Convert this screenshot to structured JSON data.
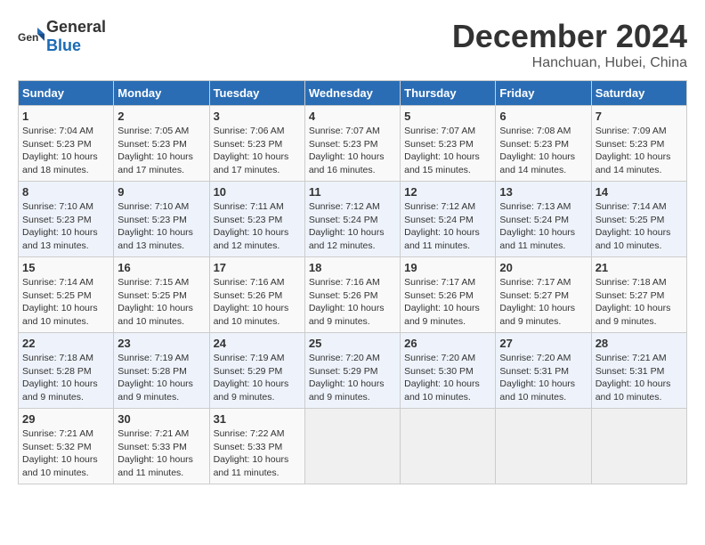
{
  "header": {
    "logo_general": "General",
    "logo_blue": "Blue",
    "month": "December 2024",
    "location": "Hanchuan, Hubei, China"
  },
  "days_of_week": [
    "Sunday",
    "Monday",
    "Tuesday",
    "Wednesday",
    "Thursday",
    "Friday",
    "Saturday"
  ],
  "weeks": [
    [
      {
        "day": "1",
        "info": "Sunrise: 7:04 AM\nSunset: 5:23 PM\nDaylight: 10 hours\nand 18 minutes."
      },
      {
        "day": "2",
        "info": "Sunrise: 7:05 AM\nSunset: 5:23 PM\nDaylight: 10 hours\nand 17 minutes."
      },
      {
        "day": "3",
        "info": "Sunrise: 7:06 AM\nSunset: 5:23 PM\nDaylight: 10 hours\nand 17 minutes."
      },
      {
        "day": "4",
        "info": "Sunrise: 7:07 AM\nSunset: 5:23 PM\nDaylight: 10 hours\nand 16 minutes."
      },
      {
        "day": "5",
        "info": "Sunrise: 7:07 AM\nSunset: 5:23 PM\nDaylight: 10 hours\nand 15 minutes."
      },
      {
        "day": "6",
        "info": "Sunrise: 7:08 AM\nSunset: 5:23 PM\nDaylight: 10 hours\nand 14 minutes."
      },
      {
        "day": "7",
        "info": "Sunrise: 7:09 AM\nSunset: 5:23 PM\nDaylight: 10 hours\nand 14 minutes."
      }
    ],
    [
      {
        "day": "8",
        "info": "Sunrise: 7:10 AM\nSunset: 5:23 PM\nDaylight: 10 hours\nand 13 minutes."
      },
      {
        "day": "9",
        "info": "Sunrise: 7:10 AM\nSunset: 5:23 PM\nDaylight: 10 hours\nand 13 minutes."
      },
      {
        "day": "10",
        "info": "Sunrise: 7:11 AM\nSunset: 5:23 PM\nDaylight: 10 hours\nand 12 minutes."
      },
      {
        "day": "11",
        "info": "Sunrise: 7:12 AM\nSunset: 5:24 PM\nDaylight: 10 hours\nand 12 minutes."
      },
      {
        "day": "12",
        "info": "Sunrise: 7:12 AM\nSunset: 5:24 PM\nDaylight: 10 hours\nand 11 minutes."
      },
      {
        "day": "13",
        "info": "Sunrise: 7:13 AM\nSunset: 5:24 PM\nDaylight: 10 hours\nand 11 minutes."
      },
      {
        "day": "14",
        "info": "Sunrise: 7:14 AM\nSunset: 5:25 PM\nDaylight: 10 hours\nand 10 minutes."
      }
    ],
    [
      {
        "day": "15",
        "info": "Sunrise: 7:14 AM\nSunset: 5:25 PM\nDaylight: 10 hours\nand 10 minutes."
      },
      {
        "day": "16",
        "info": "Sunrise: 7:15 AM\nSunset: 5:25 PM\nDaylight: 10 hours\nand 10 minutes."
      },
      {
        "day": "17",
        "info": "Sunrise: 7:16 AM\nSunset: 5:26 PM\nDaylight: 10 hours\nand 10 minutes."
      },
      {
        "day": "18",
        "info": "Sunrise: 7:16 AM\nSunset: 5:26 PM\nDaylight: 10 hours\nand 9 minutes."
      },
      {
        "day": "19",
        "info": "Sunrise: 7:17 AM\nSunset: 5:26 PM\nDaylight: 10 hours\nand 9 minutes."
      },
      {
        "day": "20",
        "info": "Sunrise: 7:17 AM\nSunset: 5:27 PM\nDaylight: 10 hours\nand 9 minutes."
      },
      {
        "day": "21",
        "info": "Sunrise: 7:18 AM\nSunset: 5:27 PM\nDaylight: 10 hours\nand 9 minutes."
      }
    ],
    [
      {
        "day": "22",
        "info": "Sunrise: 7:18 AM\nSunset: 5:28 PM\nDaylight: 10 hours\nand 9 minutes."
      },
      {
        "day": "23",
        "info": "Sunrise: 7:19 AM\nSunset: 5:28 PM\nDaylight: 10 hours\nand 9 minutes."
      },
      {
        "day": "24",
        "info": "Sunrise: 7:19 AM\nSunset: 5:29 PM\nDaylight: 10 hours\nand 9 minutes."
      },
      {
        "day": "25",
        "info": "Sunrise: 7:20 AM\nSunset: 5:29 PM\nDaylight: 10 hours\nand 9 minutes."
      },
      {
        "day": "26",
        "info": "Sunrise: 7:20 AM\nSunset: 5:30 PM\nDaylight: 10 hours\nand 10 minutes."
      },
      {
        "day": "27",
        "info": "Sunrise: 7:20 AM\nSunset: 5:31 PM\nDaylight: 10 hours\nand 10 minutes."
      },
      {
        "day": "28",
        "info": "Sunrise: 7:21 AM\nSunset: 5:31 PM\nDaylight: 10 hours\nand 10 minutes."
      }
    ],
    [
      {
        "day": "29",
        "info": "Sunrise: 7:21 AM\nSunset: 5:32 PM\nDaylight: 10 hours\nand 10 minutes."
      },
      {
        "day": "30",
        "info": "Sunrise: 7:21 AM\nSunset: 5:33 PM\nDaylight: 10 hours\nand 11 minutes."
      },
      {
        "day": "31",
        "info": "Sunrise: 7:22 AM\nSunset: 5:33 PM\nDaylight: 10 hours\nand 11 minutes."
      },
      {
        "day": "",
        "info": ""
      },
      {
        "day": "",
        "info": ""
      },
      {
        "day": "",
        "info": ""
      },
      {
        "day": "",
        "info": ""
      }
    ]
  ]
}
